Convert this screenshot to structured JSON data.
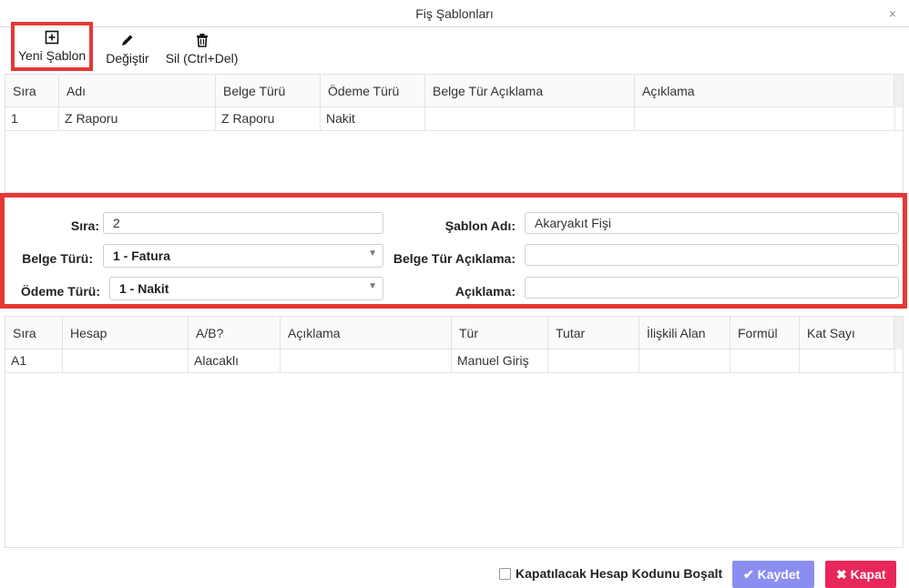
{
  "window": {
    "title": "Fiş Şablonları",
    "close_glyph": "×"
  },
  "toolbar": {
    "new_label": "Yeni Şablon",
    "edit_label": "Değiştir",
    "delete_label": "Sil (Ctrl+Del)"
  },
  "templates_grid": {
    "headers": [
      "Sıra",
      "Adı",
      "Belge Türü",
      "Ödeme Türü",
      "Belge Tür Açıklama",
      "Açıklama"
    ],
    "rows": [
      [
        "1",
        "Z Raporu",
        "Z Raporu",
        "Nakit",
        "",
        ""
      ]
    ]
  },
  "form": {
    "sira_label": "Sıra:",
    "sira_value": "2",
    "belge_turu_label": "Belge Türü:",
    "belge_turu_value": "1 - Fatura",
    "odeme_turu_label": "Ödeme Türü:",
    "odeme_turu_value": "1 - Nakit",
    "sablon_adi_label": "Şablon Adı:",
    "sablon_adi_value": "Akaryakıt Fişi",
    "belge_tur_aciklama_label": "Belge Tür Açıklama:",
    "belge_tur_aciklama_value": "",
    "aciklama_label": "Açıklama:",
    "aciklama_value": ""
  },
  "lines_grid": {
    "headers": [
      "Sıra",
      "Hesap",
      "A/B?",
      "Açıklama",
      "Tür",
      "Tutar",
      "İlişkili Alan",
      "Formül",
      "Kat Sayı"
    ],
    "rows": [
      [
        "A1",
        "",
        "Alacaklı",
        "",
        "Manuel Giriş",
        "",
        "",
        "",
        ""
      ]
    ]
  },
  "footer": {
    "checkbox_label": "Kapatılacak Hesap Kodunu Boşalt",
    "checkbox_checked": false,
    "save_label": "Kaydet",
    "cancel_label": "Kapat"
  },
  "colors": {
    "highlight": "#e53935",
    "save_button": "#8b8ef0",
    "cancel_button": "#e8265a"
  }
}
